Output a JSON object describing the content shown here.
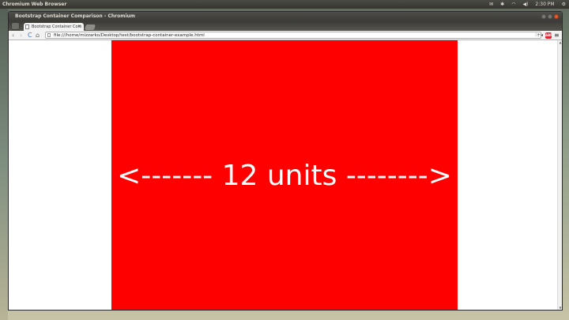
{
  "topbar": {
    "app_name": "Chromium Web Browser",
    "clock": "2:30 PM",
    "icons": [
      "mail-icon",
      "bluetooth-icon",
      "wifi-icon",
      "volume-icon",
      "clock",
      "gear-icon"
    ]
  },
  "window": {
    "title": "Bootstrap Container Comparison - Chromium"
  },
  "tab": {
    "label": "Bootstrap Container Com",
    "close": "×"
  },
  "toolbar": {
    "back": "‹",
    "forward": "›",
    "reload": "C",
    "home": "⌂",
    "url": "file:///home/mizzarko/Desktop/test/bootstrap-container-example.html",
    "star": "☆",
    "ext": "+◂",
    "abp": "ABP",
    "menu": "≡"
  },
  "page": {
    "container_label": "<------- 12 units -------->"
  },
  "colors": {
    "container": "#ff0000",
    "page_bg": "#ffffff"
  }
}
